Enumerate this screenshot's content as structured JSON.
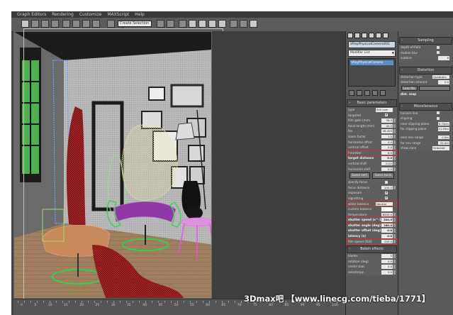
{
  "menubar": {
    "items": [
      "Graph Editors",
      "Rendering",
      "Customize",
      "MAXScript",
      "Help"
    ]
  },
  "toolbar": {
    "view_dropdown": "Create Selection Se"
  },
  "command_panel": {
    "object_name": "VRayPhysicalCamera001",
    "modifier_list": "Modifier List",
    "stack_item": "VRayPhysicalCamera",
    "basic_parameters": {
      "title": "Basic parameters",
      "type_label": "type",
      "type_value": "Still cam",
      "targeted": "targeted",
      "targeted_check": "✔",
      "film_gate": "film gate (mm)",
      "film_gate_value": "36.0",
      "focal_length": "focal length (mm)",
      "focal_length_value": "40.0",
      "fov": "fov",
      "fov_value": "48.455",
      "zoom_factor": "zoom factor",
      "zoom_factor_value": "1.0",
      "horizontal_offset": "horizontal offset",
      "horizontal_offset_value": "0.0",
      "vertical_offset": "vertical offset",
      "vertical_offset_value": "0.0",
      "f_number": "f-number",
      "f_number_value": "8.0",
      "target_distance": "target distance",
      "target_distance_value": "5.0",
      "vertical_shift": "vertical shift",
      "vertical_shift_value": "-0.02",
      "horizontal_shift": "horizontal shift",
      "horizontal_shift_value": "0.0",
      "guess_vert": "Guess vert.",
      "guess_horiz": "Guess horiz.",
      "specify_focus": "specify focus",
      "focus_distance": "focus distance",
      "focus_distance_value": "200.0",
      "exposure": "exposure",
      "exposure_check": "✔",
      "vignetting": "vignetting",
      "vignetting_check": "✔",
      "white_balance": "white balance",
      "white_balance_value": "Neutral",
      "custom_balance": "custom balance",
      "temperature": "temperature",
      "temperature_value": "6500.0",
      "shutter_speed": "shutter speed (s^-1)",
      "shutter_speed_value": "200.0",
      "shutter_angle": "shutter angle (deg)",
      "shutter_angle_value": "180.0",
      "shutter_offset": "shutter offset (deg)",
      "shutter_offset_value": "0.0",
      "latency": "latency (s)",
      "latency_value": "0.0",
      "film_speed": "film speed (ISO)",
      "film_speed_value": "200.0"
    },
    "bokeh": {
      "title": "Bokeh effects",
      "blades": "blades",
      "blades_value": "5",
      "rotation": "rotation (deg)",
      "rotation_value": "0.0",
      "center_bias": "center bias",
      "center_bias_value": "0.0",
      "anisotropy": "anisotropy",
      "anisotropy_value": "0.0"
    }
  },
  "right_panel": {
    "sampling": {
      "title": "Sampling",
      "depth_of_field": "depth-of-field",
      "motion_blur": "motion blur",
      "subdivs": "subdivs",
      "subdivs_value": "6"
    },
    "distortion": {
      "title": "Distortion",
      "distortion_type": "distortion type",
      "distortion_type_value": "Quadratic",
      "distortion_amount": "distortion amount",
      "distortion_amount_value": "0.0",
      "lens_file": "Lens file",
      "dist_map": "dist. map"
    },
    "misc": {
      "title": "Miscellaneous",
      "horizon_line": "horizon line",
      "clipping": "clipping",
      "near_clip": "near clipping plane",
      "near_clip_value": "6.74cm",
      "far_clip": "far clipping plane",
      "far_clip_value": "11.93m",
      "near_env": "near env range",
      "near_env_value": "0.0m",
      "far_env": "far env range",
      "far_env_value": "25.4m",
      "show_cone": "show cone",
      "show_cone_value": "Selected"
    }
  },
  "ruler": {
    "ticks": [
      "0",
      "5",
      "10",
      "15",
      "20",
      "25",
      "30",
      "35",
      "40",
      "45",
      "50",
      "55",
      "60",
      "65",
      "70",
      "75",
      "80",
      "85",
      "90",
      "95",
      "100"
    ]
  },
  "watermark": "3Dmax吧 【www.linecg.com/tieba/1771】",
  "colors": {
    "highlight": "#d03030",
    "viewport_frame": "#c8c8b0"
  }
}
